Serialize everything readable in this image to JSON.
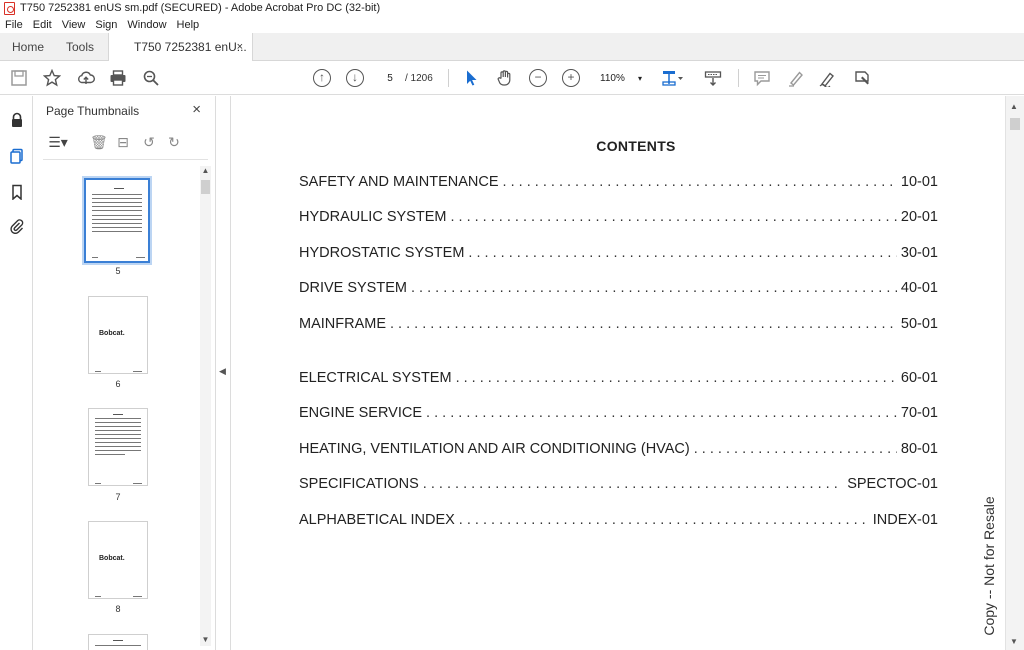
{
  "window": {
    "title": "T750 7252381 enUS sm.pdf (SECURED) - Adobe Acrobat Pro DC (32-bit)"
  },
  "menu": [
    "File",
    "Edit",
    "View",
    "Sign",
    "Window",
    "Help"
  ],
  "tabs": {
    "home": "Home",
    "tools": "Tools",
    "doc": "T750 7252381 enU...",
    "close": "×"
  },
  "toolbar": {
    "page_current": "5",
    "page_total": "/ 1206",
    "zoom": "110%",
    "zoom_caret": "▾"
  },
  "thumbnails": {
    "header": "Page Thumbnails",
    "close": "×",
    "pages": [
      {
        "label": "5",
        "logo": ""
      },
      {
        "label": "6",
        "logo": "Bobcat."
      },
      {
        "label": "7",
        "logo": ""
      },
      {
        "label": "8",
        "logo": "Bobcat."
      }
    ]
  },
  "document": {
    "title": "CONTENTS",
    "toc": [
      {
        "name": "SAFETY AND MAINTENANCE",
        "page": "10-01"
      },
      {
        "name": "HYDRAULIC SYSTEM",
        "page": "20-01"
      },
      {
        "name": "HYDROSTATIC SYSTEM",
        "page": "30-01"
      },
      {
        "name": "DRIVE SYSTEM",
        "page": "40-01"
      },
      {
        "name": "MAINFRAME",
        "page": "50-01"
      },
      {
        "name": "ELECTRICAL SYSTEM",
        "page": "60-01"
      },
      {
        "name": "ENGINE SERVICE",
        "page": "70-01"
      },
      {
        "name": "HEATING, VENTILATION AND AIR CONDITIONING (HVAC)",
        "page": "80-01"
      },
      {
        "name": "SPECIFICATIONS",
        "page": "SPECTOC-01"
      },
      {
        "name": "ALPHABETICAL INDEX",
        "page": "INDEX-01"
      }
    ],
    "watermark": "Copy -- Not for Resale"
  },
  "colors": {
    "accent": "#3a7fd5",
    "selection_glow": "#bcd5f3"
  }
}
